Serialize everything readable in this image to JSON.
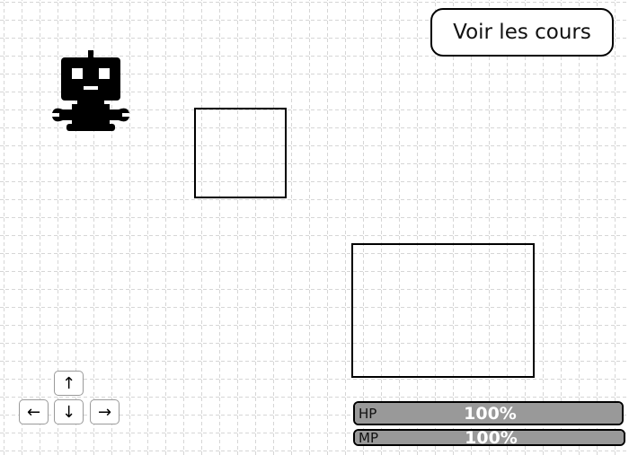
{
  "header": {
    "courses_button_label": "Voir les cours"
  },
  "player": {
    "icon": "robot-icon"
  },
  "controls": {
    "up": "↑",
    "left": "←",
    "down": "↓",
    "right": "→"
  },
  "stats": {
    "hp": {
      "label": "HP",
      "value_text": "100%",
      "fraction": 1.0
    },
    "mp": {
      "label": "MP",
      "value_text": "100%",
      "fraction": 1.0
    }
  },
  "colors": {
    "grid_line": "#c8c8c8",
    "bar_fill": "#999999",
    "robot": "#000000"
  }
}
